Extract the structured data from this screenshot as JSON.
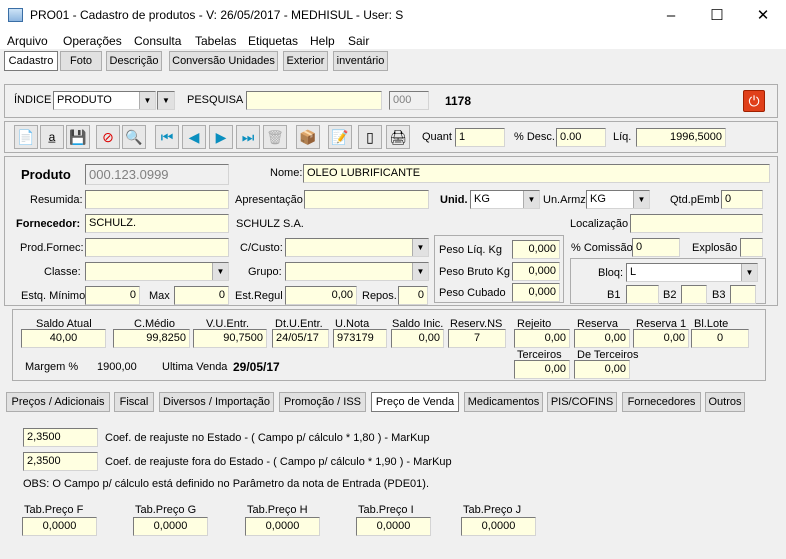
{
  "window": {
    "title": "PRO01 - Cadastro de produtos - V: 26/05/2017 - MEDHISUL - User: S"
  },
  "menu": [
    "Arquivo",
    "Operações",
    "Consulta",
    "Tabelas",
    "Etiquetas",
    "Help",
    "Sair"
  ],
  "top_tabs": [
    "Cadastro",
    "Foto",
    "Descrição",
    "Conversão Unidades",
    "Exterior",
    "inventário"
  ],
  "search": {
    "indice_label": "ÍNDICE",
    "indice_value": "PRODUTO",
    "pesquisa_label": "PESQUISA",
    "pesquisa_value": "",
    "code": "000",
    "count": "1178"
  },
  "toolbar": {
    "quant_label": "Quant",
    "quant_value": "1",
    "desc_label": "% Desc.",
    "desc_value": "0.00",
    "liq_label": "Líq.",
    "liq_value": "1996,5000"
  },
  "product": {
    "produto_label": "Produto",
    "produto_value": "000.123.0999",
    "nome_label": "Nome:",
    "nome_value": "OLEO LUBRIFICANTE",
    "resumida_label": "Resumida:",
    "resumida_value": "",
    "apresentacao_label": "Apresentação",
    "apresentacao_value": "",
    "unid_label": "Unid.",
    "unid_value": "KG",
    "unarmz_label": "Un.Armz",
    "unarmz_value": "KG",
    "qtdpemb_label": "Qtd.pEmb",
    "qtdpemb_value": "0",
    "fornecedor_label": "Fornecedor:",
    "fornecedor_value": "SCHULZ.",
    "fornecedor_name": "SCHULZ S.A.",
    "localizacao_label": "Localização",
    "localizacao_value": "",
    "prodfornec_label": "Prod.Fornec:",
    "prodfornec_value": "",
    "ccusto_label": "C/Custo:",
    "ccusto_value": "",
    "pesoliq_label": "Peso Líq. Kg",
    "pesoliq_value": "0,000",
    "comissao_label": "% Comissão",
    "comissao_value": "0",
    "explosao_label": "Explosão",
    "explosao_value": "",
    "classe_label": "Classe:",
    "classe_value": "",
    "grupo_label": "Grupo:",
    "grupo_value": "",
    "pesobruto_label": "Peso Bruto Kg",
    "pesobruto_value": "0,000",
    "bloq_label": "Bloq:",
    "bloq_value": "L",
    "estqmin_label": "Estq. Mínimo",
    "estqmin_value": "0",
    "max_label": "Max",
    "max_value": "0",
    "estregul_label": "Est.Regul",
    "estregul_value": "0,00",
    "repos_label": "Repos.",
    "repos_value": "0",
    "pesocubado_label": "Peso Cubado",
    "pesocubado_value": "0,000",
    "b1_label": "B1",
    "b2_label": "B2",
    "b3_label": "B3"
  },
  "stock": {
    "saldo_atual_label": "Saldo Atual",
    "saldo_atual": "40,00",
    "cmedio_label": "C.Médio",
    "cmedio": "99,8250",
    "vuentr_label": "V.U.Entr.",
    "vuentr": "90,7500",
    "dtuentr_label": "Dt.U.Entr.",
    "dtuentr": "24/05/17",
    "unota_label": "U.Nota",
    "unota": "973179",
    "saldoinic_label": "Saldo Inic.",
    "saldoinic": "0,00",
    "reservns_label": "Reserv.NS",
    "reservns": "7",
    "rejeito_label": "Rejeito",
    "rejeito": "0,00",
    "reserva_label": "Reserva",
    "reserva": "0,00",
    "reserva1_label": "Reserva 1",
    "reserva1": "0,00",
    "bllote_label": "Bl.Lote",
    "bllote": "0",
    "terceiros_label": "Terceiros",
    "terceiros": "0,00",
    "deterceiros_label": "De Terceiros",
    "deterceiros": "0,00",
    "margem_label": "Margem  %",
    "margem": "1900,00",
    "ultimavenda_label": "Ultima Venda",
    "ultimavenda": "29/05/17"
  },
  "bottom_tabs": [
    "Preços / Adicionais",
    "Fiscal",
    "Diversos / Importação",
    "Promoção / ISS",
    "Preço de Venda",
    "Medicamentos",
    "PIS/COFINS",
    "Fornecedores",
    "Outros"
  ],
  "pricing": {
    "coef1_value": "2,3500",
    "coef1_text": "Coef. de reajuste no Estado    -   ( Campo p/ cálculo * 1,80 ) - MarKup",
    "coef2_value": "2,3500",
    "coef2_text": "Coef. de reajuste fora do Estado  -  ( Campo p/ cálculo * 1,90 ) - MarKup",
    "obs": "OBS: O Campo p/ cálculo está definido no Parâmetro da nota de Entrada (PDE01).",
    "tabs": [
      {
        "label": "Tab.Preço F",
        "value": "0,0000"
      },
      {
        "label": "Tab.Preço G",
        "value": "0,0000"
      },
      {
        "label": "Tab.Preço H",
        "value": "0,0000"
      },
      {
        "label": "Tab.Preço I",
        "value": "0,0000"
      },
      {
        "label": "Tab.Preço J",
        "value": "0,0000"
      }
    ]
  }
}
